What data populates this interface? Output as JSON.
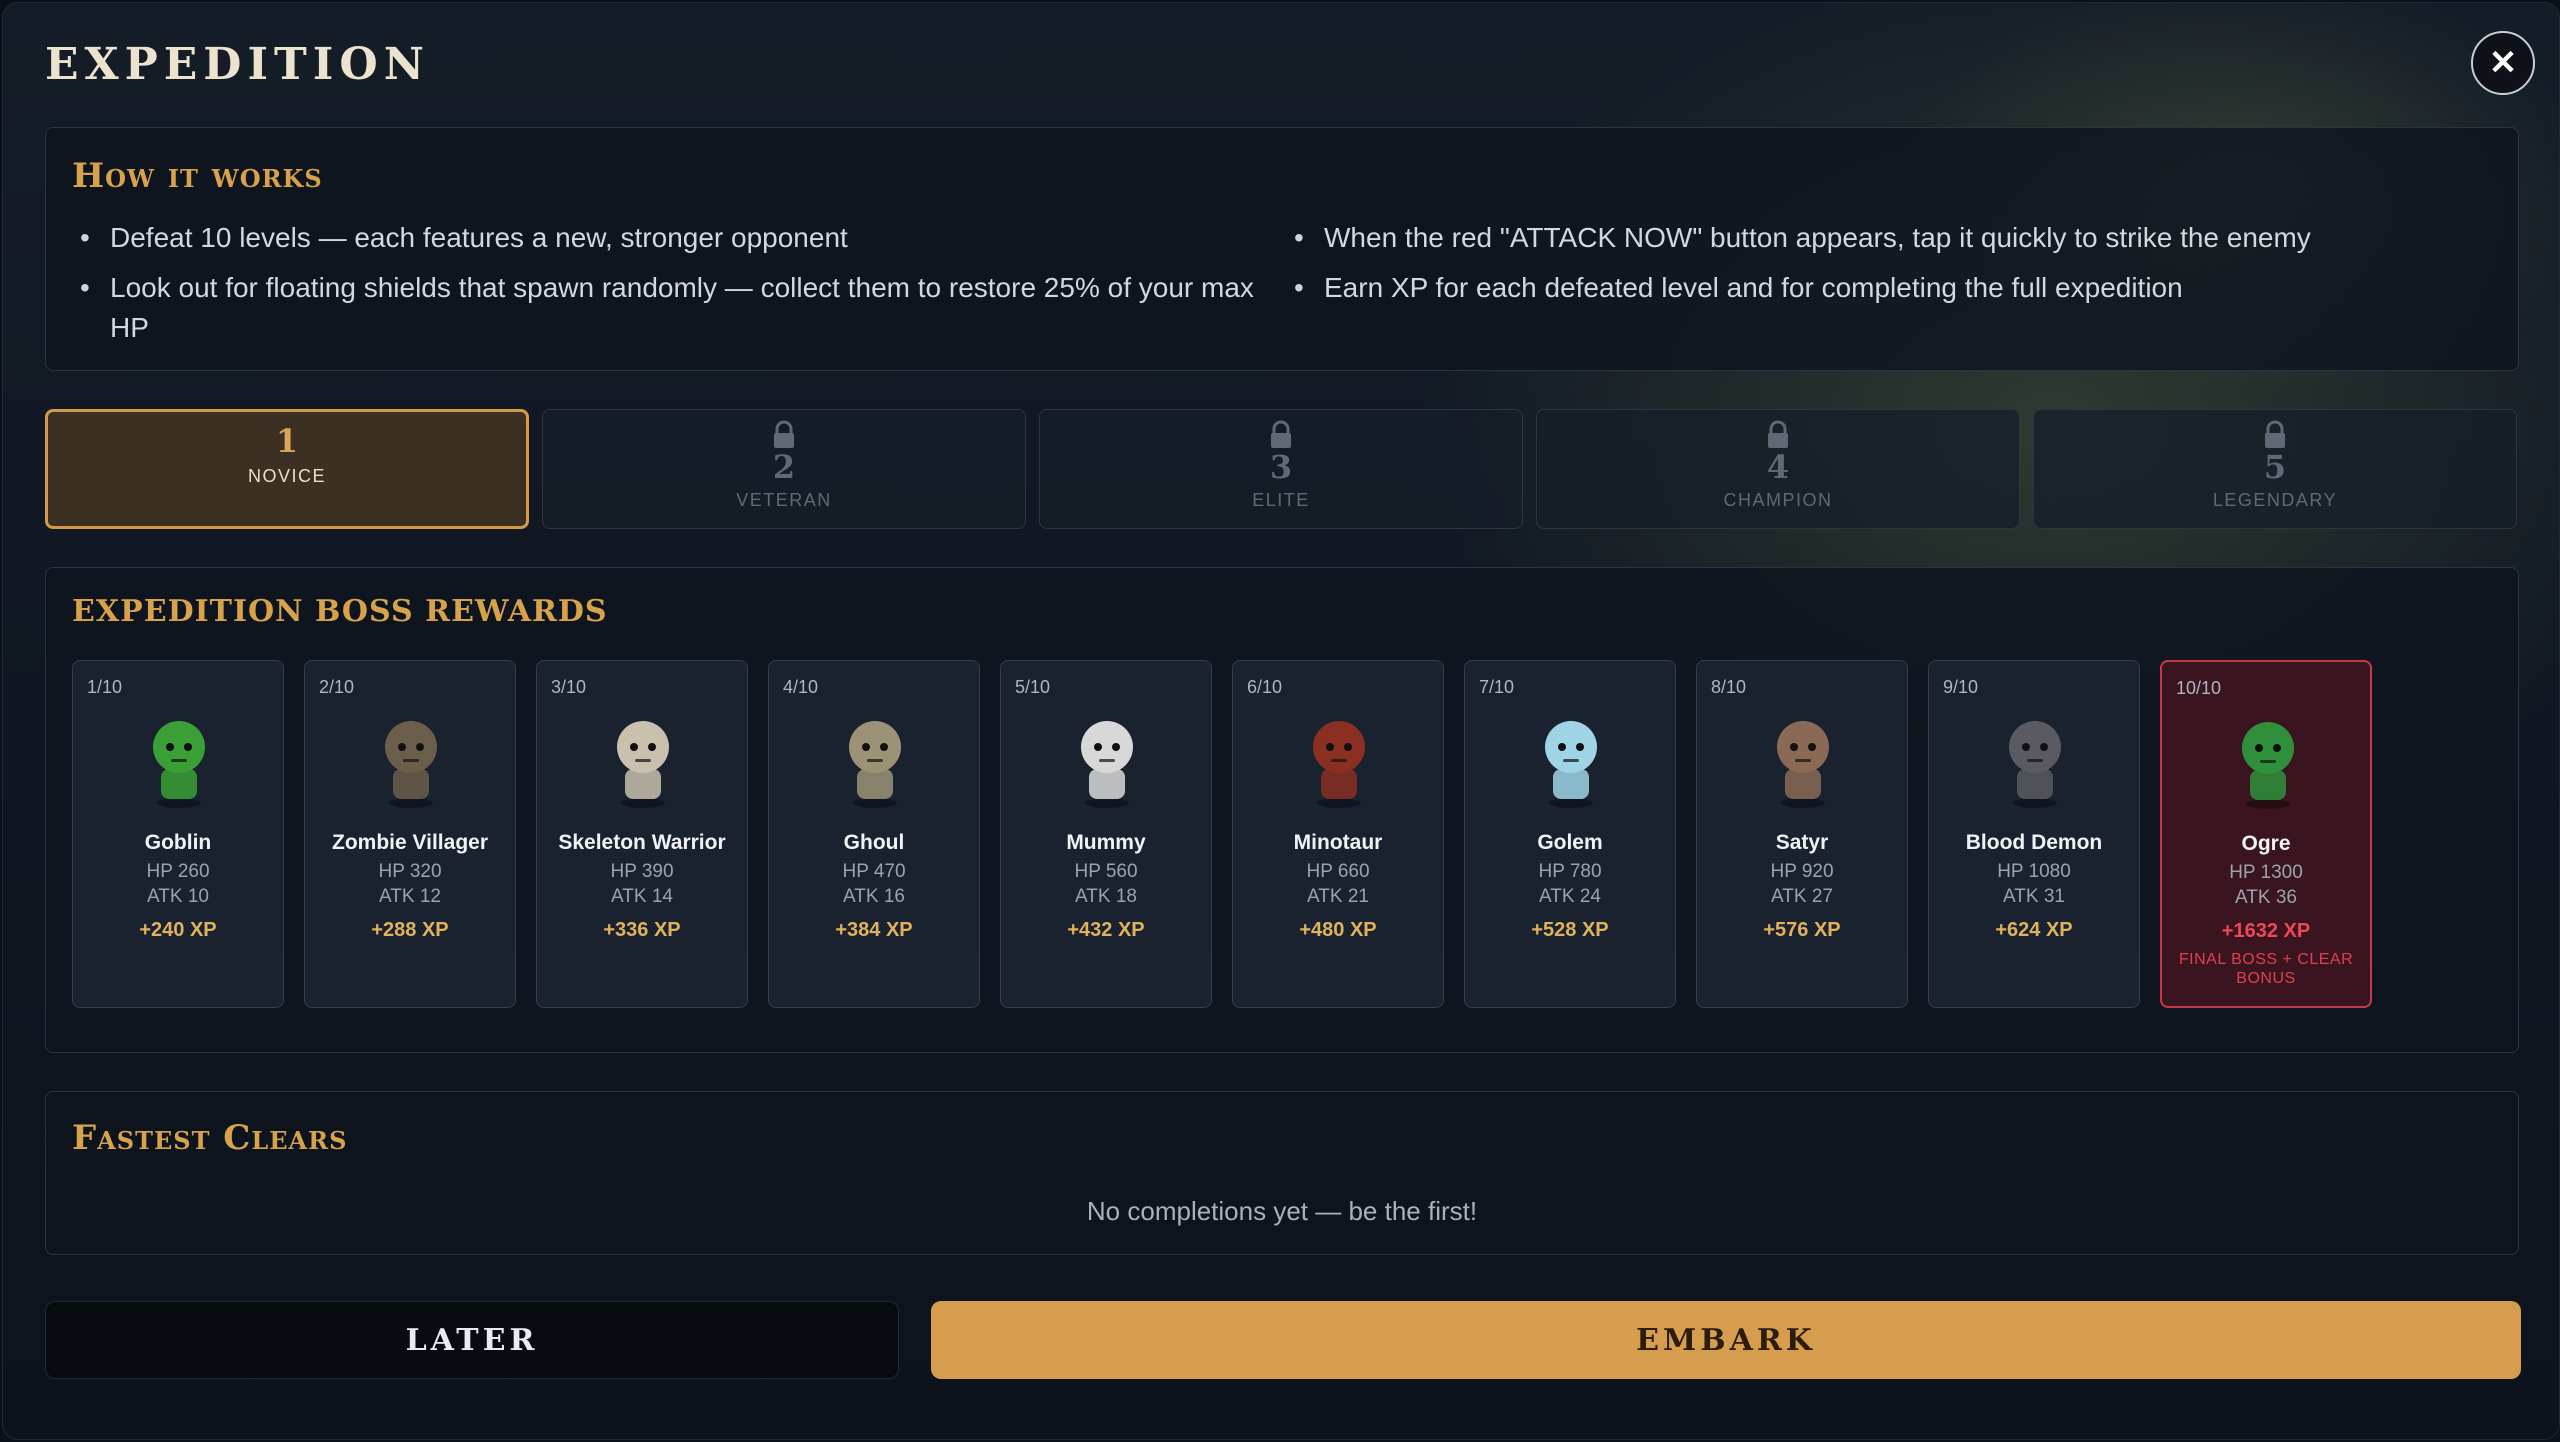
{
  "modal": {
    "title": "EXPEDITION",
    "close_icon": "close-icon"
  },
  "how_it_works": {
    "title": "How it works",
    "left_bullets": [
      "Defeat 10 levels — each features a new, stronger opponent",
      "Look out for floating shields that spawn randomly — collect them to restore 25% of your max HP"
    ],
    "right_bullets": [
      "When the red \"ATTACK NOW\" button appears, tap it quickly to strike the enemy",
      "Earn XP for each defeated level and for completing the full expedition"
    ]
  },
  "tiers": [
    {
      "num": "1",
      "name": "NOVICE",
      "locked": false,
      "selected": true
    },
    {
      "num": "2",
      "name": "VETERAN",
      "locked": true,
      "selected": false
    },
    {
      "num": "3",
      "name": "ELITE",
      "locked": true,
      "selected": false
    },
    {
      "num": "4",
      "name": "CHAMPION",
      "locked": true,
      "selected": false
    },
    {
      "num": "5",
      "name": "LEGENDARY",
      "locked": true,
      "selected": false
    }
  ],
  "rewards": {
    "title": "Expedition Boss Rewards",
    "bosses": [
      {
        "idx": "1/10",
        "name": "Goblin",
        "hp": "HP 260",
        "atk": "ATK 10",
        "xp": "+240 XP",
        "color": "#3aa035"
      },
      {
        "idx": "2/10",
        "name": "Zombie Villager",
        "hp": "HP 320",
        "atk": "ATK 12",
        "xp": "+288 XP",
        "color": "#6b5e4a"
      },
      {
        "idx": "3/10",
        "name": "Skeleton Warrior",
        "hp": "HP 390",
        "atk": "ATK 14",
        "xp": "+336 XP",
        "color": "#c9c0ad"
      },
      {
        "idx": "4/10",
        "name": "Ghoul",
        "hp": "HP 470",
        "atk": "ATK 16",
        "xp": "+384 XP",
        "color": "#9c9275"
      },
      {
        "idx": "5/10",
        "name": "Mummy",
        "hp": "HP 560",
        "atk": "ATK 18",
        "xp": "+432 XP",
        "color": "#d8d8d8"
      },
      {
        "idx": "6/10",
        "name": "Minotaur",
        "hp": "HP 660",
        "atk": "ATK 21",
        "xp": "+480 XP",
        "color": "#8a2f22"
      },
      {
        "idx": "7/10",
        "name": "Golem",
        "hp": "HP 780",
        "atk": "ATK 24",
        "xp": "+528 XP",
        "color": "#9fd3e6"
      },
      {
        "idx": "8/10",
        "name": "Satyr",
        "hp": "HP 920",
        "atk": "ATK 27",
        "xp": "+576 XP",
        "color": "#8b6a55"
      },
      {
        "idx": "9/10",
        "name": "Blood Demon",
        "hp": "HP 1080",
        "atk": "ATK 31",
        "xp": "+624 XP",
        "color": "#5a5a62"
      },
      {
        "idx": "10/10",
        "name": "Ogre",
        "hp": "HP 1300",
        "atk": "ATK 36",
        "xp": "+1632 XP",
        "note": "FINAL BOSS + CLEAR BONUS",
        "color": "#2f8f3a"
      }
    ]
  },
  "fastest": {
    "title": "Fastest Clears",
    "empty": "No completions yet — be the first!"
  },
  "actions": {
    "later": "LATER",
    "embark": "EMBARK"
  }
}
